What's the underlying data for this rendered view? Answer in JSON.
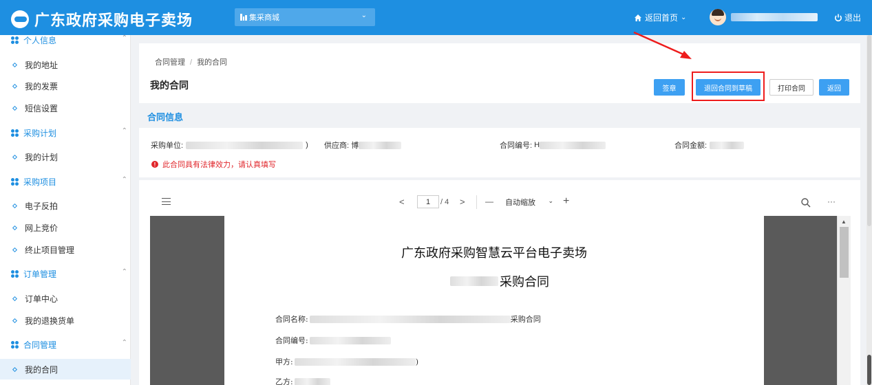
{
  "header": {
    "logo_text": "广东政府采购电子卖场",
    "mall_select": "集采商城",
    "home_link": "返回首页",
    "logout": "退出"
  },
  "sidebar": {
    "groups": [
      {
        "label": "个人信息",
        "items": [
          "我的地址",
          "我的发票",
          "短信设置"
        ]
      },
      {
        "label": "采购计划",
        "items": [
          "我的计划"
        ]
      },
      {
        "label": "采购项目",
        "items": [
          "电子反拍",
          "网上竞价",
          "终止项目管理"
        ]
      },
      {
        "label": "订单管理",
        "items": [
          "订单中心",
          "我的退换货单"
        ]
      },
      {
        "label": "合同管理",
        "items": [
          "我的合同"
        ]
      }
    ],
    "active_item": "我的合同"
  },
  "breadcrumb": {
    "parent": "合同管理",
    "separator": "/",
    "current": "我的合同"
  },
  "page_title": "我的合同",
  "actions": {
    "sign": "签章",
    "return_draft": "退回合同到草稿",
    "print": "打印合同",
    "back": "返回"
  },
  "contract_info": {
    "section_title": "合同信息",
    "purchaser_label": "采购单位:",
    "purchaser_tail": ")",
    "supplier_label": "供应商:",
    "supplier_prefix": "博",
    "number_label": "合同编号:",
    "number_prefix": "H",
    "amount_label": "合同金额:",
    "warning": "此合同具有法律效力，请认真填写"
  },
  "pdf_viewer": {
    "prev": "<",
    "current_page": "1",
    "total_pages": "/ 4",
    "next": ">",
    "zoom_out": "—",
    "zoom_level": "自动缩放",
    "zoom_in": "+",
    "more": "···"
  },
  "document": {
    "title": "广东政府采购智慧云平台电子卖场",
    "subtitle_tail": "采购合同",
    "name_label": "合同名称:",
    "name_tail": "采购合同",
    "number_label": "合同编号:",
    "party_a_label": "甲方:",
    "party_a_tail": ")",
    "party_b_label": "乙方:"
  },
  "colors": {
    "primary": "#1e8fe1",
    "button": "#3da0f2",
    "warning": "#e0262b",
    "highlight": "#ee1c1c"
  }
}
